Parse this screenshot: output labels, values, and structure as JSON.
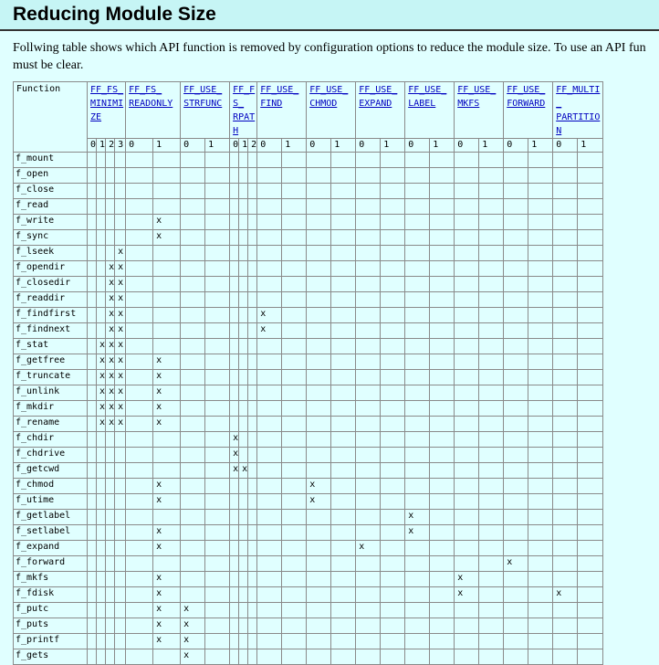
{
  "title": "Reducing Module Size",
  "intro_lines": [
    "Follwing table shows which API function is removed by configuration options to reduce the module size. To use an API fun",
    "must be clear."
  ],
  "table": {
    "function_header": "Function",
    "options": [
      {
        "lines": [
          "FF_FS_",
          "MINIMIZE"
        ],
        "values": [
          "0",
          "1",
          "2",
          "3"
        ]
      },
      {
        "lines": [
          "FF_FS_",
          "READONLY"
        ],
        "values": [
          "0",
          "1"
        ]
      },
      {
        "lines": [
          "FF_USE_",
          "STRFUNC"
        ],
        "values": [
          "0",
          "1"
        ]
      },
      {
        "lines": [
          "FF_FS_",
          "RPATH"
        ],
        "values": [
          "0",
          "1",
          "2"
        ]
      },
      {
        "lines": [
          "FF_USE_",
          "FIND"
        ],
        "values": [
          "0",
          "1"
        ]
      },
      {
        "lines": [
          "FF_USE_",
          "CHMOD"
        ],
        "values": [
          "0",
          "1"
        ]
      },
      {
        "lines": [
          "FF_USE_",
          "EXPAND"
        ],
        "values": [
          "0",
          "1"
        ]
      },
      {
        "lines": [
          "FF_USE_",
          "LABEL"
        ],
        "values": [
          "0",
          "1"
        ]
      },
      {
        "lines": [
          "FF_USE_",
          "MKFS"
        ],
        "values": [
          "0",
          "1"
        ]
      },
      {
        "lines": [
          "FF_USE_",
          "FORWARD"
        ],
        "values": [
          "0",
          "1"
        ]
      },
      {
        "lines": [
          "FF_MULTI_",
          "PARTITION"
        ],
        "values": [
          "0",
          "1"
        ]
      }
    ],
    "rows": [
      {
        "fn": "f_mount",
        "cells": [
          "",
          "",
          "",
          "",
          "",
          "",
          "",
          "",
          "",
          "",
          "",
          "",
          "",
          "",
          "",
          "",
          "",
          "",
          "",
          "",
          "",
          "",
          "",
          "",
          ""
        ]
      },
      {
        "fn": "f_open",
        "cells": [
          "",
          "",
          "",
          "",
          "",
          "",
          "",
          "",
          "",
          "",
          "",
          "",
          "",
          "",
          "",
          "",
          "",
          "",
          "",
          "",
          "",
          "",
          "",
          "",
          ""
        ]
      },
      {
        "fn": "f_close",
        "cells": [
          "",
          "",
          "",
          "",
          "",
          "",
          "",
          "",
          "",
          "",
          "",
          "",
          "",
          "",
          "",
          "",
          "",
          "",
          "",
          "",
          "",
          "",
          "",
          "",
          ""
        ]
      },
      {
        "fn": "f_read",
        "cells": [
          "",
          "",
          "",
          "",
          "",
          "",
          "",
          "",
          "",
          "",
          "",
          "",
          "",
          "",
          "",
          "",
          "",
          "",
          "",
          "",
          "",
          "",
          "",
          "",
          ""
        ]
      },
      {
        "fn": "f_write",
        "cells": [
          "",
          "",
          "",
          "",
          "",
          "x",
          "",
          "",
          "",
          "",
          "",
          "",
          "",
          "",
          "",
          "",
          "",
          "",
          "",
          "",
          "",
          "",
          "",
          "",
          ""
        ]
      },
      {
        "fn": "f_sync",
        "cells": [
          "",
          "",
          "",
          "",
          "",
          "x",
          "",
          "",
          "",
          "",
          "",
          "",
          "",
          "",
          "",
          "",
          "",
          "",
          "",
          "",
          "",
          "",
          "",
          "",
          ""
        ]
      },
      {
        "fn": "f_lseek",
        "cells": [
          "",
          "",
          "",
          "x",
          "",
          "",
          "",
          "",
          "",
          "",
          "",
          "",
          "",
          "",
          "",
          "",
          "",
          "",
          "",
          "",
          "",
          "",
          "",
          "",
          ""
        ]
      },
      {
        "fn": "f_opendir",
        "cells": [
          "",
          "",
          "x",
          "x",
          "",
          "",
          "",
          "",
          "",
          "",
          "",
          "",
          "",
          "",
          "",
          "",
          "",
          "",
          "",
          "",
          "",
          "",
          "",
          "",
          ""
        ]
      },
      {
        "fn": "f_closedir",
        "cells": [
          "",
          "",
          "x",
          "x",
          "",
          "",
          "",
          "",
          "",
          "",
          "",
          "",
          "",
          "",
          "",
          "",
          "",
          "",
          "",
          "",
          "",
          "",
          "",
          "",
          ""
        ]
      },
      {
        "fn": "f_readdir",
        "cells": [
          "",
          "",
          "x",
          "x",
          "",
          "",
          "",
          "",
          "",
          "",
          "",
          "",
          "",
          "",
          "",
          "",
          "",
          "",
          "",
          "",
          "",
          "",
          "",
          "",
          ""
        ]
      },
      {
        "fn": "f_findfirst",
        "cells": [
          "",
          "",
          "x",
          "x",
          "",
          "",
          "",
          "",
          "",
          "",
          "",
          "x",
          "",
          "",
          "",
          "",
          "",
          "",
          "",
          "",
          "",
          "",
          "",
          "",
          ""
        ]
      },
      {
        "fn": "f_findnext",
        "cells": [
          "",
          "",
          "x",
          "x",
          "",
          "",
          "",
          "",
          "",
          "",
          "",
          "x",
          "",
          "",
          "",
          "",
          "",
          "",
          "",
          "",
          "",
          "",
          "",
          "",
          ""
        ]
      },
      {
        "fn": "f_stat",
        "cells": [
          "",
          "x",
          "x",
          "x",
          "",
          "",
          "",
          "",
          "",
          "",
          "",
          "",
          "",
          "",
          "",
          "",
          "",
          "",
          "",
          "",
          "",
          "",
          "",
          "",
          ""
        ]
      },
      {
        "fn": "f_getfree",
        "cells": [
          "",
          "x",
          "x",
          "x",
          "",
          "x",
          "",
          "",
          "",
          "",
          "",
          "",
          "",
          "",
          "",
          "",
          "",
          "",
          "",
          "",
          "",
          "",
          "",
          "",
          ""
        ]
      },
      {
        "fn": "f_truncate",
        "cells": [
          "",
          "x",
          "x",
          "x",
          "",
          "x",
          "",
          "",
          "",
          "",
          "",
          "",
          "",
          "",
          "",
          "",
          "",
          "",
          "",
          "",
          "",
          "",
          "",
          "",
          ""
        ]
      },
      {
        "fn": "f_unlink",
        "cells": [
          "",
          "x",
          "x",
          "x",
          "",
          "x",
          "",
          "",
          "",
          "",
          "",
          "",
          "",
          "",
          "",
          "",
          "",
          "",
          "",
          "",
          "",
          "",
          "",
          "",
          ""
        ]
      },
      {
        "fn": "f_mkdir",
        "cells": [
          "",
          "x",
          "x",
          "x",
          "",
          "x",
          "",
          "",
          "",
          "",
          "",
          "",
          "",
          "",
          "",
          "",
          "",
          "",
          "",
          "",
          "",
          "",
          "",
          "",
          ""
        ]
      },
      {
        "fn": "f_rename",
        "cells": [
          "",
          "x",
          "x",
          "x",
          "",
          "x",
          "",
          "",
          "",
          "",
          "",
          "",
          "",
          "",
          "",
          "",
          "",
          "",
          "",
          "",
          "",
          "",
          "",
          "",
          ""
        ]
      },
      {
        "fn": "f_chdir",
        "cells": [
          "",
          "",
          "",
          "",
          "",
          "",
          "",
          "",
          "x",
          "",
          "",
          "",
          "",
          "",
          "",
          "",
          "",
          "",
          "",
          "",
          "",
          "",
          "",
          "",
          ""
        ]
      },
      {
        "fn": "f_chdrive",
        "cells": [
          "",
          "",
          "",
          "",
          "",
          "",
          "",
          "",
          "x",
          "",
          "",
          "",
          "",
          "",
          "",
          "",
          "",
          "",
          "",
          "",
          "",
          "",
          "",
          "",
          ""
        ]
      },
      {
        "fn": "f_getcwd",
        "cells": [
          "",
          "",
          "",
          "",
          "",
          "",
          "",
          "",
          "x",
          "x",
          "",
          "",
          "",
          "",
          "",
          "",
          "",
          "",
          "",
          "",
          "",
          "",
          "",
          "",
          ""
        ]
      },
      {
        "fn": "f_chmod",
        "cells": [
          "",
          "",
          "",
          "",
          "",
          "x",
          "",
          "",
          "",
          "",
          "",
          "",
          "",
          "x",
          "",
          "",
          "",
          "",
          "",
          "",
          "",
          "",
          "",
          "",
          ""
        ]
      },
      {
        "fn": "f_utime",
        "cells": [
          "",
          "",
          "",
          "",
          "",
          "x",
          "",
          "",
          "",
          "",
          "",
          "",
          "",
          "x",
          "",
          "",
          "",
          "",
          "",
          "",
          "",
          "",
          "",
          "",
          ""
        ]
      },
      {
        "fn": "f_getlabel",
        "cells": [
          "",
          "",
          "",
          "",
          "",
          "",
          "",
          "",
          "",
          "",
          "",
          "",
          "",
          "",
          "",
          "",
          "",
          "x",
          "",
          "",
          "",
          "",
          "",
          "",
          ""
        ]
      },
      {
        "fn": "f_setlabel",
        "cells": [
          "",
          "",
          "",
          "",
          "",
          "x",
          "",
          "",
          "",
          "",
          "",
          "",
          "",
          "",
          "",
          "",
          "",
          "x",
          "",
          "",
          "",
          "",
          "",
          "",
          ""
        ]
      },
      {
        "fn": "f_expand",
        "cells": [
          "",
          "",
          "",
          "",
          "",
          "x",
          "",
          "",
          "",
          "",
          "",
          "",
          "",
          "",
          "",
          "x",
          "",
          "",
          "",
          "",
          "",
          "",
          "",
          "",
          ""
        ]
      },
      {
        "fn": "f_forward",
        "cells": [
          "",
          "",
          "",
          "",
          "",
          "",
          "",
          "",
          "",
          "",
          "",
          "",
          "",
          "",
          "",
          "",
          "",
          "",
          "",
          "",
          "",
          "x",
          "",
          "",
          ""
        ]
      },
      {
        "fn": "f_mkfs",
        "cells": [
          "",
          "",
          "",
          "",
          "",
          "x",
          "",
          "",
          "",
          "",
          "",
          "",
          "",
          "",
          "",
          "",
          "",
          "",
          "",
          "x",
          "",
          "",
          "",
          "",
          ""
        ]
      },
      {
        "fn": "f_fdisk",
        "cells": [
          "",
          "",
          "",
          "",
          "",
          "x",
          "",
          "",
          "",
          "",
          "",
          "",
          "",
          "",
          "",
          "",
          "",
          "",
          "",
          "x",
          "",
          "",
          "",
          "x",
          ""
        ]
      },
      {
        "fn": "f_putc",
        "cells": [
          "",
          "",
          "",
          "",
          "",
          "x",
          "x",
          "",
          "",
          "",
          "",
          "",
          "",
          "",
          "",
          "",
          "",
          "",
          "",
          "",
          "",
          "",
          "",
          "",
          ""
        ]
      },
      {
        "fn": "f_puts",
        "cells": [
          "",
          "",
          "",
          "",
          "",
          "x",
          "x",
          "",
          "",
          "",
          "",
          "",
          "",
          "",
          "",
          "",
          "",
          "",
          "",
          "",
          "",
          "",
          "",
          "",
          ""
        ]
      },
      {
        "fn": "f_printf",
        "cells": [
          "",
          "",
          "",
          "",
          "",
          "x",
          "x",
          "",
          "",
          "",
          "",
          "",
          "",
          "",
          "",
          "",
          "",
          "",
          "",
          "",
          "",
          "",
          "",
          "",
          ""
        ]
      },
      {
        "fn": "f_gets",
        "cells": [
          "",
          "",
          "",
          "",
          "",
          "",
          "x",
          "",
          "",
          "",
          "",
          "",
          "",
          "",
          "",
          "",
          "",
          "",
          "",
          "",
          "",
          "",
          "",
          "",
          ""
        ]
      }
    ]
  }
}
